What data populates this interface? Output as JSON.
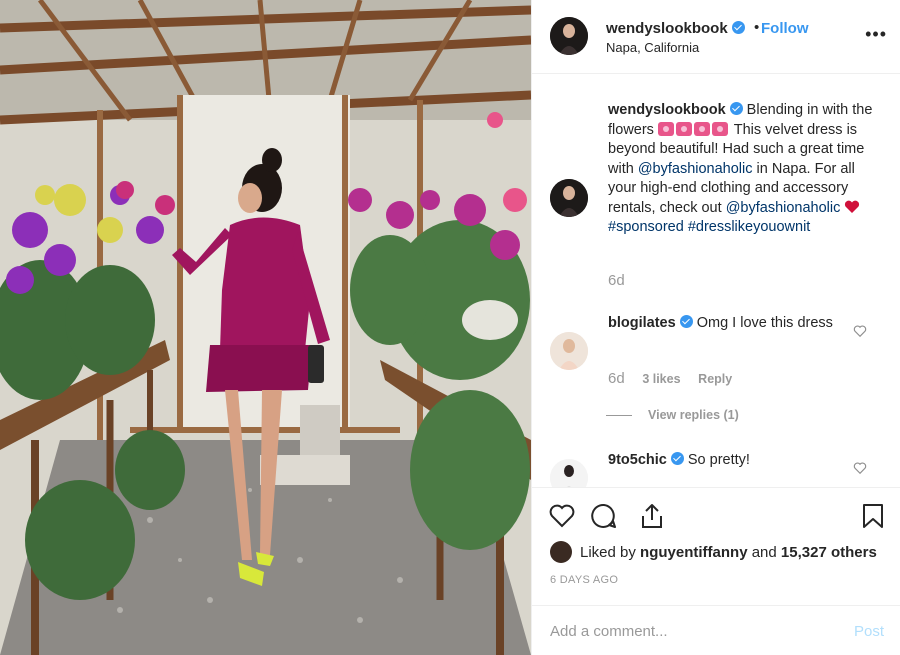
{
  "header": {
    "username": "wendyslookbook",
    "dot": "•",
    "follow_label": "Follow",
    "location": "Napa, California",
    "more_label": "•••"
  },
  "caption": {
    "username": "wendyslookbook",
    "text_1": "Blending in with the flowers",
    "text_2": "This velvet dress is beyond beautiful! Had such a great time with",
    "mention_1": "@byfashionaholic",
    "text_3": "in Napa. For all your high-end clothing and accessory rentals, check out",
    "mention_2": "@byfashionaholic",
    "hashtag_1": "#sponsored",
    "hashtag_2": "#dresslikeyouownit",
    "time": "6d"
  },
  "comments": [
    {
      "username": "blogilates",
      "text": "Omg I love this dress",
      "time": "6d",
      "likes": "3 likes",
      "reply_label": "Reply",
      "view_replies": "View replies (1)"
    },
    {
      "username": "9to5chic",
      "text": "So pretty!"
    }
  ],
  "likes": {
    "prefix": "Liked by",
    "user": "nguyentiffanny",
    "conj": "and",
    "count": "15,327 others"
  },
  "date": "6 DAYS AGO",
  "add_comment": {
    "placeholder": "Add a comment...",
    "post_label": "Post"
  },
  "colors": {
    "accent": "#3897f0",
    "link": "#003569",
    "muted": "#999999",
    "dress": "#a0155e",
    "heart": "#ed4956"
  },
  "icons": [
    "heart-icon",
    "comment-icon",
    "share-icon",
    "bookmark-icon",
    "verified-badge-icon",
    "more-options-icon"
  ]
}
